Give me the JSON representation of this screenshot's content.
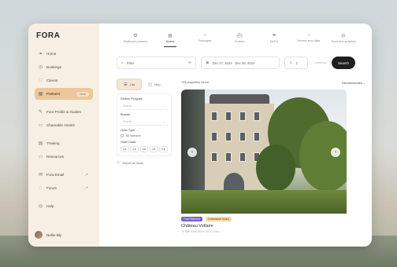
{
  "app": {
    "logo": "FORA"
  },
  "sidebar": {
    "items": [
      {
        "label": "Home",
        "icon": "leaf-icon"
      },
      {
        "label": "Bookings",
        "icon": "calendar-icon"
      },
      {
        "label": "Clients",
        "icon": "heart-icon"
      },
      {
        "label": "Partners",
        "icon": "building-icon",
        "badge": "New",
        "active": true
      }
    ],
    "items2": [
      {
        "label": "Fora Profile & Guides",
        "icon": "edit-icon"
      },
      {
        "label": "Shareable Assets",
        "icon": "folder-icon"
      }
    ],
    "items3": [
      {
        "label": "Training",
        "icon": "book-icon"
      },
      {
        "label": "Resources",
        "icon": "folder-icon"
      }
    ],
    "items4": [
      {
        "label": "Fora Email",
        "icon": "mail-icon"
      },
      {
        "label": "Forum",
        "icon": "chat-icon"
      }
    ],
    "help": "Help",
    "user": "Nellie Bly"
  },
  "tabs": [
    {
      "label": "Preferred partners"
    },
    {
      "label": "Hotels",
      "active": true
    },
    {
      "label": "Packages"
    },
    {
      "label": "Cruises"
    },
    {
      "label": "DMCs"
    },
    {
      "label": "Homes and villas"
    },
    {
      "label": "Tours and activities"
    }
  ],
  "search": {
    "location": "Paris",
    "dates": "Dec 27, 2024 · Dec 28, 2024",
    "guests": "2",
    "currency": "Currency",
    "button": "Search"
  },
  "view": {
    "list": "List",
    "map": "Map"
  },
  "filters": {
    "partner_program": "Partner Program",
    "partner_program_value": "Search",
    "brands": "Brands",
    "brands_value": "Search",
    "hotel_type": "Hotel Type",
    "hotel_type_option": "All inclusive",
    "hotel_class": "Hotel Class",
    "stars": [
      "1★",
      "2★",
      "3★",
      "4★",
      "5★"
    ]
  },
  "report": "Report an issue",
  "results": {
    "count": "723 properties found",
    "sort": "Recommended"
  },
  "card": {
    "tag1": "Fora Preferred",
    "tag2": "Commission bonus",
    "title": "Château Voltaire",
    "subtitle": "55 Rue Saint-Roch, 75001 Paris"
  }
}
